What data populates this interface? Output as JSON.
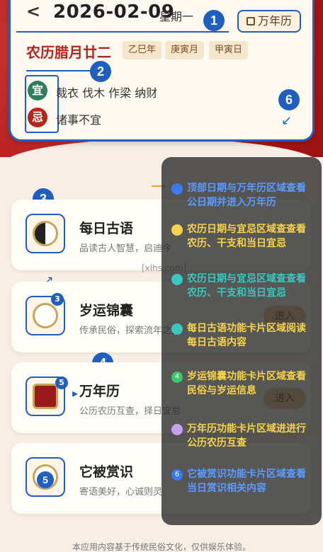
{
  "header": {
    "back_icon": "chevron-left-icon",
    "date": "2026-02-09",
    "weekday": "星期一",
    "wannianli_label": "万年历",
    "lunar_date": "农历腊月廿二",
    "ganzhi": [
      "乙巳年",
      "庚寅月",
      "甲寅日"
    ],
    "yi_label": "宜",
    "yi_text": "裁衣 伐木 作梁 纳财",
    "ji_label": "忌",
    "ji_text": "诸事不宜"
  },
  "markers": {
    "m1": "1",
    "m2": "2",
    "m3": "3",
    "m4": "4",
    "m5": "5",
    "m6": "6"
  },
  "features": [
    {
      "title": "每日古语",
      "subtitle": "品读古人智慧，启迪今",
      "icon": "yin-yang-icon"
    },
    {
      "title": "岁运锦囊",
      "subtitle": "传承民俗，探索流年之美",
      "icon": "compass-icon",
      "button": "进入"
    },
    {
      "title": "万年历",
      "subtitle": "公历农历互查，择日宜忌",
      "icon": "calendar-book-icon",
      "button": "进入"
    },
    {
      "title": "它被赏识",
      "subtitle": "寄语美好，心诚则灵",
      "icon": "badge-icon"
    }
  ],
  "legend": [
    {
      "text": "顶部日期与万年历区域查看公日期并进入万年历",
      "color": "#3b7bf0"
    },
    {
      "text": "农历日期与宜忌区域查查看农历、干支和当日宜忌",
      "color": "#f5d34a"
    },
    {
      "text": "农历日期与宜忌区域查查看农历、干支和当日宜忌",
      "color": "#36c9c0"
    },
    {
      "text": "每日古语功能卡片区域阅读每日古语内容",
      "color": "#36c9c0"
    },
    {
      "text": "岁运锦囊功能卡片区域查看民俗与岁运信息",
      "color": "#3ac86a"
    },
    {
      "text": "万年历功能卡片区域进进行公历农历互查",
      "color": "#c9a0f0"
    },
    {
      "text": "它被赏识功能卡片区域查看当日赏识相关内容",
      "color": "#3b7bf0"
    }
  ],
  "legend_badges": {
    "b4": "4",
    "b6": "6"
  },
  "watermark": "[xlhs.com]",
  "footer": "本应用内容基于传统民俗文化，仅供娱乐体验。"
}
